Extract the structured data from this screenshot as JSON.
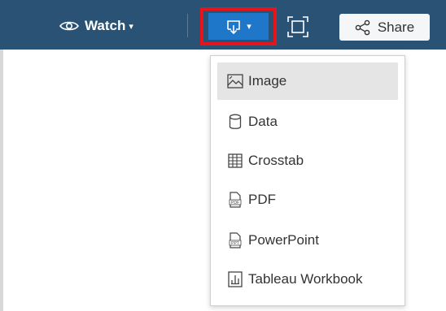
{
  "toolbar": {
    "watch_label": "Watch",
    "share_label": "Share",
    "watch_caret": "▾",
    "download_caret": "▾"
  },
  "colors": {
    "toolbar_bg": "#2a5275",
    "download_bg": "#1f77c9",
    "highlight_border": "#e8141b",
    "menu_active_bg": "#e5e5e5"
  },
  "download_menu": {
    "items": [
      {
        "label": "Image",
        "icon": "image-icon",
        "active": true
      },
      {
        "label": "Data",
        "icon": "database-icon",
        "active": false
      },
      {
        "label": "Crosstab",
        "icon": "table-grid-icon",
        "active": false
      },
      {
        "label": "PDF",
        "icon": "pdf-file-icon",
        "active": false
      },
      {
        "label": "PowerPoint",
        "icon": "ppt-file-icon",
        "active": false
      },
      {
        "label": "Tableau Workbook",
        "icon": "workbook-icon",
        "active": false
      }
    ]
  }
}
